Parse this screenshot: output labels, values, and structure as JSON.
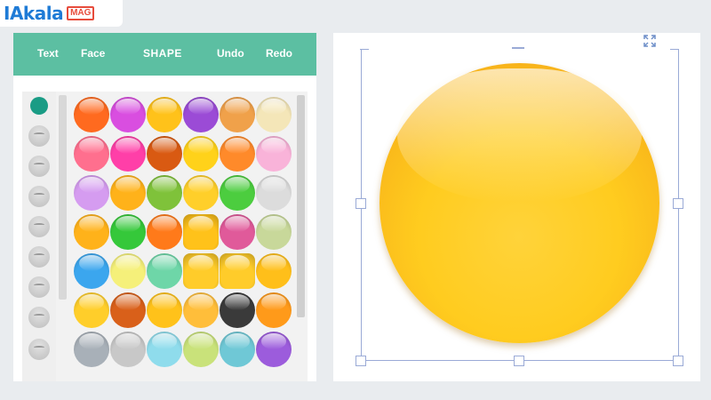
{
  "logo": {
    "main": "IAkala",
    "badge": "MAG"
  },
  "toolbar": {
    "text": "Text",
    "face": "Face",
    "shape": "SHAPE",
    "undo": "Undo",
    "redo": "Redo"
  },
  "colors": {
    "toolbar": "#5cbfa2",
    "accent": "#1a9c85",
    "shape": "#ffcc1f"
  },
  "side_icons": [
    "face-shape-selected",
    "devil-face",
    "smile-face",
    "eyes-face",
    "squint-face",
    "grin-face",
    "open-mouth-face",
    "neutral-face",
    "hair-face"
  ],
  "shapes": [
    [
      "#ff6a1f",
      "#d94ee0",
      "#ffc21a",
      "#9b4bd6",
      "#f0a14a",
      "#f4e6b8"
    ],
    [
      "#ff6f8e",
      "#ff3fa8",
      "#d95a12",
      "#ffd21a",
      "#ff8a2a",
      "#f9b3d9"
    ],
    [
      "#d59cf0",
      "#ffb21a",
      "#7fc23a",
      "#ffcf2a",
      "#4ccd3f",
      "#dcdcdc"
    ],
    [
      "#ffb21a",
      "#35c83a",
      "#ff7a1a",
      "#ffc21a",
      "#e05a9a",
      "#c8d89a"
    ],
    [
      "#3ba6ee",
      "#f5f07a",
      "#6ed6a8",
      "#ffcc2a",
      "#ffcc2a",
      "#ffbf1a"
    ],
    [
      "#ffce2a",
      "#d9601a",
      "#ffc21a",
      "#ffbe3a",
      "#3a3a3a",
      "#ff9a1a"
    ],
    [
      "#a8b0b8",
      "#c8c8c8",
      "#8fdcec",
      "#c9e27a",
      "#6fc8d6",
      "#9c5cdc"
    ]
  ]
}
